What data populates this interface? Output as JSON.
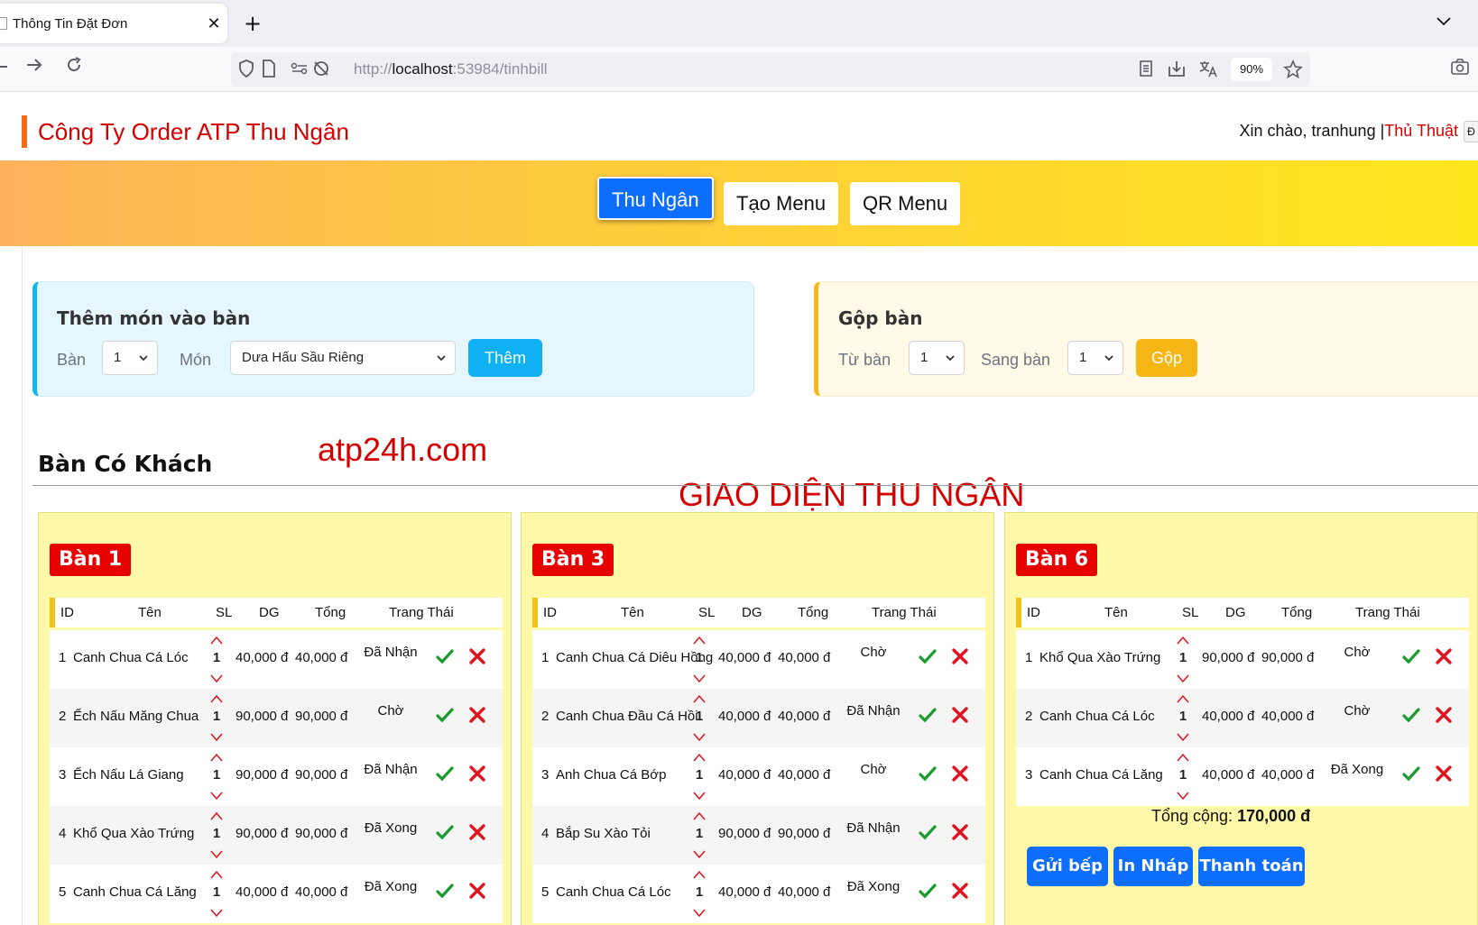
{
  "browser": {
    "tab_title": "Thông Tin Đặt Đơn",
    "tab_close": "✕",
    "new_tab": "+",
    "url_prefix": "http://",
    "url_host": "localhost",
    "url_rest": ":53984/tinhbill",
    "zoom": "90%"
  },
  "header": {
    "brand": "Công Ty Order ATP Thu Ngân",
    "greeting": "Xin chào, tranhung |",
    "greeting_link": "Thủ Thuật",
    "greeting_edge": "Đ"
  },
  "nav": {
    "items": [
      {
        "label": "Thu Ngân",
        "active": true
      },
      {
        "label": "Tạo Menu",
        "active": false
      },
      {
        "label": "QR Menu",
        "active": false
      }
    ]
  },
  "add_panel": {
    "title": "Thêm món vào bàn",
    "table_label": "Bàn",
    "table_value": "1",
    "dish_label": "Món",
    "dish_value": "Dưa Hấu Sầu Riêng",
    "button": "Thêm"
  },
  "merge_panel": {
    "title": "Gộp bàn",
    "from_label": "Từ bàn",
    "from_value": "1",
    "to_label": "Sang bàn",
    "to_value": "1",
    "button": "Gộp"
  },
  "section": {
    "title": "Bàn Có Khách",
    "watermark1": "atp24h.com",
    "watermark2": "GIAO DIỆN THU NGÂN"
  },
  "columns": [
    "ID",
    "Tên",
    "SL",
    "DG",
    "Tổng",
    "Trang Thái"
  ],
  "tables": [
    {
      "name": "Bàn 1",
      "rows": [
        {
          "id": "1",
          "name": "Canh Chua Cá Lóc",
          "qty": "1",
          "price": "40,000 đ",
          "total": "40,000 đ",
          "status": "Đã Nhận"
        },
        {
          "id": "2",
          "name": "Ếch Nấu Măng Chua",
          "qty": "1",
          "price": "90,000 đ",
          "total": "90,000 đ",
          "status": "Chờ"
        },
        {
          "id": "3",
          "name": "Ếch Nấu Lá Giang",
          "qty": "1",
          "price": "90,000 đ",
          "total": "90,000 đ",
          "status": "Đã Nhận"
        },
        {
          "id": "4",
          "name": "Khổ Qua Xào Trứng",
          "qty": "1",
          "price": "90,000 đ",
          "total": "90,000 đ",
          "status": "Đã Xong"
        },
        {
          "id": "5",
          "name": "Canh Chua Cá Lăng",
          "qty": "1",
          "price": "40,000 đ",
          "total": "40,000 đ",
          "status": "Đã Xong"
        }
      ]
    },
    {
      "name": "Bàn 3",
      "rows": [
        {
          "id": "1",
          "name": "Canh Chua Cá Diêu Hồng",
          "qty": "1",
          "price": "40,000 đ",
          "total": "40,000 đ",
          "status": "Chờ"
        },
        {
          "id": "2",
          "name": "Canh Chua Đầu Cá Hồi",
          "qty": "1",
          "price": "40,000 đ",
          "total": "40,000 đ",
          "status": "Đã Nhận"
        },
        {
          "id": "3",
          "name": "Anh Chua Cá Bớp",
          "qty": "1",
          "price": "40,000 đ",
          "total": "40,000 đ",
          "status": "Chờ"
        },
        {
          "id": "4",
          "name": "Bắp Su Xào Tỏi",
          "qty": "1",
          "price": "90,000 đ",
          "total": "90,000 đ",
          "status": "Đã Nhận"
        },
        {
          "id": "5",
          "name": "Canh Chua Cá Lóc",
          "qty": "1",
          "price": "40,000 đ",
          "total": "40,000 đ",
          "status": "Đã Xong"
        }
      ]
    },
    {
      "name": "Bàn 6",
      "rows": [
        {
          "id": "1",
          "name": "Khổ Qua Xào Trứng",
          "qty": "1",
          "price": "90,000 đ",
          "total": "90,000 đ",
          "status": "Chờ"
        },
        {
          "id": "2",
          "name": "Canh Chua Cá Lóc",
          "qty": "1",
          "price": "40,000 đ",
          "total": "40,000 đ",
          "status": "Chờ"
        },
        {
          "id": "3",
          "name": "Canh Chua Cá Lăng",
          "qty": "1",
          "price": "40,000 đ",
          "total": "40,000 đ",
          "status": "Đã Xong"
        }
      ],
      "total_label": "Tổng cộng:",
      "total_value": "170,000 đ",
      "actions": [
        "Gửi bếp",
        "In Nháp",
        "Thanh toán"
      ]
    }
  ],
  "icons": {
    "approve": "check-icon",
    "remove": "x-icon",
    "approve_color": "#1a9b2e",
    "remove_color": "#e0141e"
  }
}
